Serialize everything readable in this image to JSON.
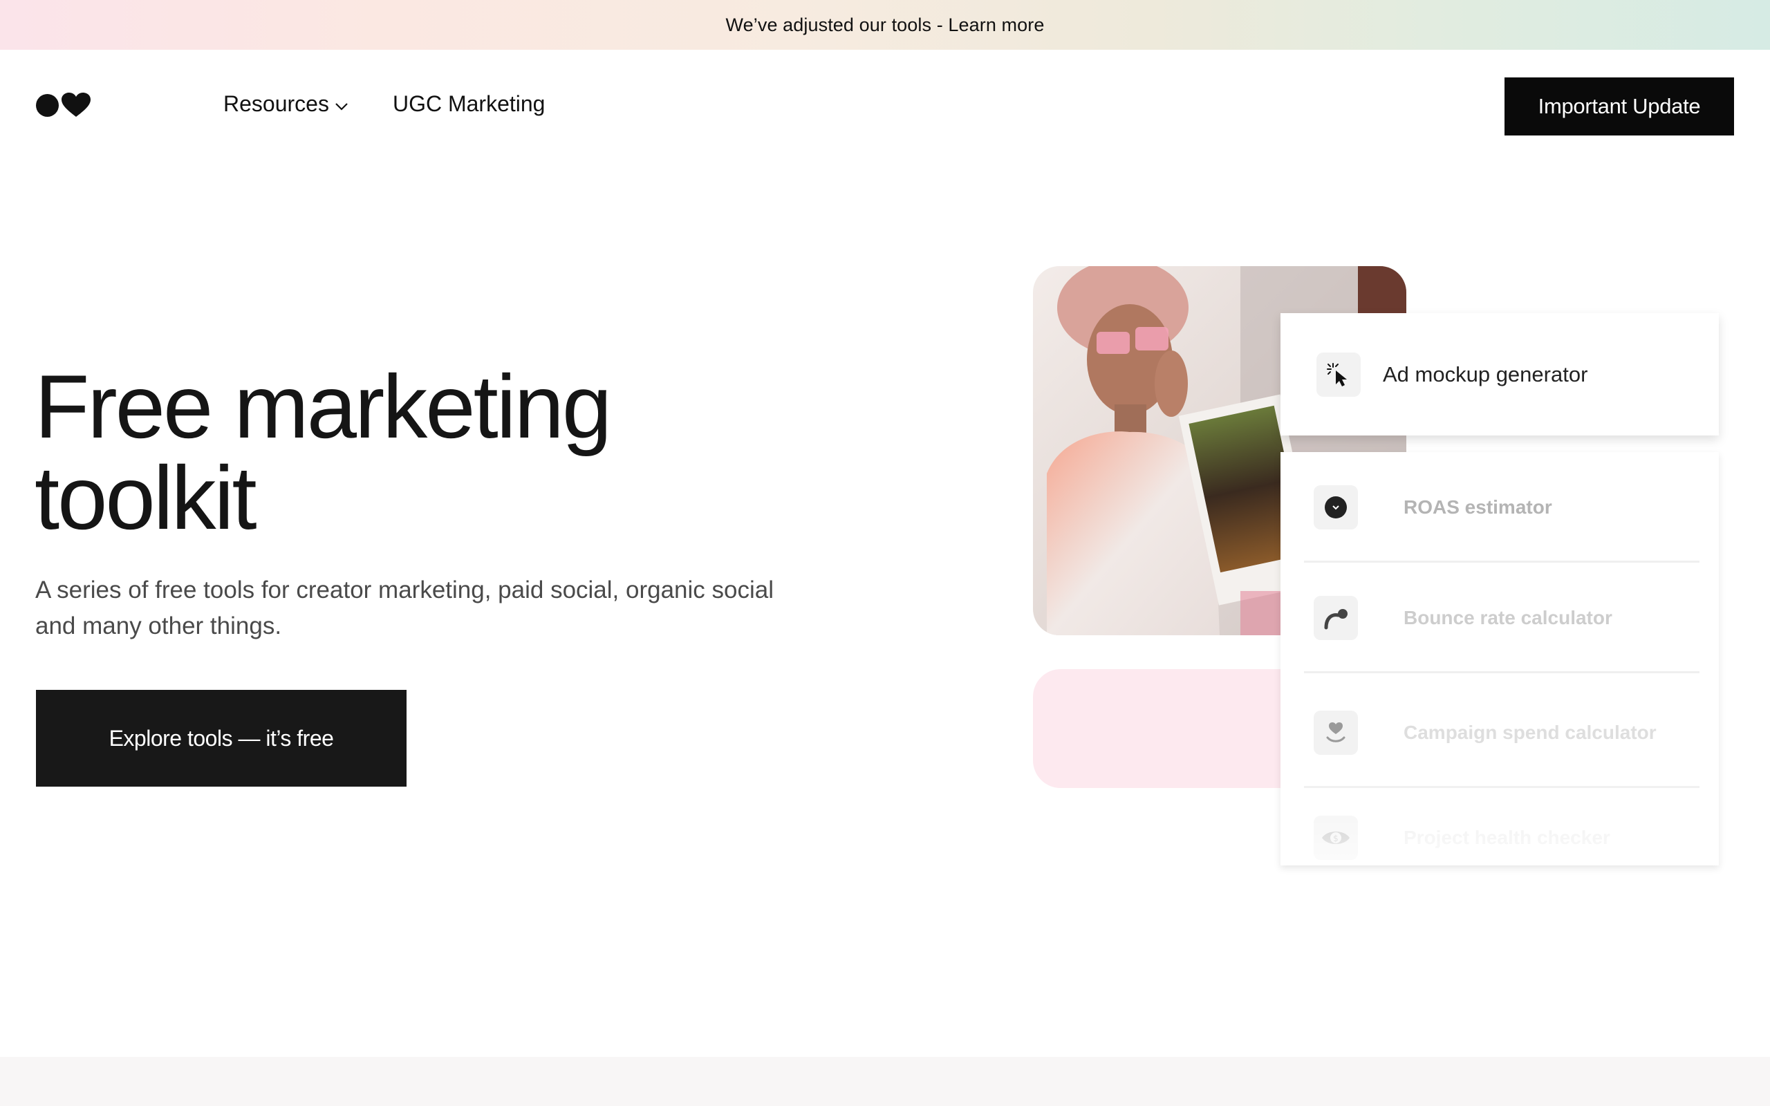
{
  "banner": {
    "text": "We’ve adjusted our tools - Learn more"
  },
  "nav": {
    "items": [
      {
        "label": "Resources",
        "has_dropdown": true
      },
      {
        "label": "UGC Marketing",
        "has_dropdown": false
      }
    ],
    "cta_label": "Important Update"
  },
  "hero": {
    "title": "Free marketing toolkit",
    "subtitle": "A series of free tools for creator marketing, paid social, organic social and many other things.",
    "cta_label": "Explore tools — it’s free"
  },
  "tools": {
    "active": {
      "label": "Ad mockup generator",
      "icon": "cursor-click-icon"
    },
    "items": [
      {
        "label": "ROAS estimator",
        "icon": "clock-face-icon",
        "color": "#b4b4b4"
      },
      {
        "label": "Bounce rate calculator",
        "icon": "bounce-arc-icon",
        "color": "#cdcdcd"
      },
      {
        "label": "Campaign spend calculator",
        "icon": "heart-smile-icon",
        "color": "#dedede"
      },
      {
        "label": "Project health checker",
        "icon": "eye-dollar-icon",
        "color": "#ececec"
      }
    ]
  },
  "colors": {
    "primary_button": "#181818",
    "text": "#151515",
    "subtitle": "#4a4a4a",
    "pink_accent": "#fde9ef",
    "bottom_strip": "#f8f6f6"
  }
}
